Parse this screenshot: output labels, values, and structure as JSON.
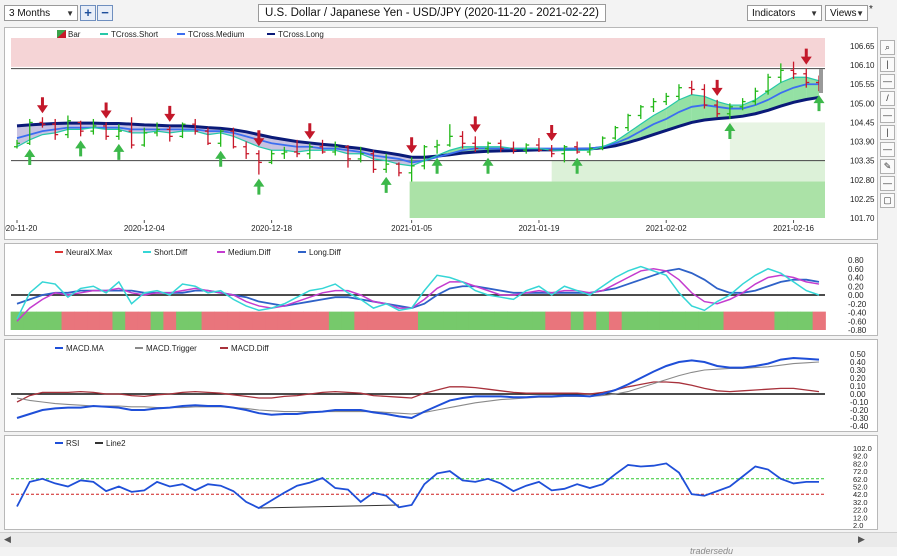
{
  "toolbar": {
    "period_select": "3 Months",
    "add_btn": "+",
    "remove_btn": "−",
    "chart_title": "U.S. Dollar / Japanese Yen - USD/JPY (2020-11-20 - 2021-02-22)",
    "indicators_select": "Indicators",
    "views_select": "Views",
    "star": "*"
  },
  "right_tools": [
    "⌕",
    "|",
    "—",
    "/",
    "—",
    "|",
    "—",
    "✎",
    "—",
    "▢"
  ],
  "watermark": "tradersedu",
  "colors": {
    "up": "#22b818",
    "down": "#c8182a",
    "tcross_short": "#27c8a8",
    "tcross_medium": "#3c6ef0",
    "tcross_long": "#0a1a78",
    "short_diff": "#35d6d6",
    "medium_diff": "#c43ccf",
    "long_diff": "#2f62c8",
    "macd_ma": "#1f4fd8",
    "macd_trigger": "#8a8a8a",
    "macd_diff": "#a8323c",
    "rsi": "#1f4fd8",
    "line2": "#333333",
    "level_green": "#2ec82e",
    "level_red": "#cf1f1f"
  },
  "chart_data": [
    {
      "type": "candlestick",
      "legend": [
        "Bar",
        "TCross.Short",
        "TCross.Medium",
        "TCross.Long"
      ],
      "x_tick_labels": [
        "2020-11-20",
        "2020-12-04",
        "2020-12-18",
        "2021-01-05",
        "2021-01-19",
        "2021-02-02",
        "2021-02-16"
      ],
      "x_tick_index": [
        0,
        10,
        20,
        31,
        41,
        51,
        61
      ],
      "y_tick_labels": [
        "106.65",
        "106.10",
        "105.55",
        "105.00",
        "104.45",
        "103.90",
        "103.35",
        "102.80",
        "102.25",
        "101.70"
      ],
      "ylim": [
        101.7,
        106.65
      ],
      "ohlc": [
        [
          103.75,
          103.95,
          103.7,
          103.85
        ],
        [
          103.85,
          104.55,
          103.8,
          104.45
        ],
        [
          104.45,
          104.6,
          104.3,
          104.4
        ],
        [
          104.4,
          104.55,
          103.95,
          104.1
        ],
        [
          104.1,
          104.65,
          104.0,
          104.5
        ],
        [
          104.45,
          104.5,
          104.05,
          104.2
        ],
        [
          104.2,
          104.55,
          104.1,
          104.35
        ],
        [
          104.35,
          104.45,
          103.95,
          104.05
        ],
        [
          104.05,
          104.4,
          103.95,
          104.2
        ],
        [
          104.2,
          104.6,
          103.7,
          103.8
        ],
        [
          103.8,
          104.3,
          103.75,
          104.15
        ],
        [
          104.15,
          104.45,
          104.05,
          104.25
        ],
        [
          104.25,
          104.35,
          103.9,
          104.05
        ],
        [
          104.05,
          104.45,
          104.0,
          104.4
        ],
        [
          104.4,
          104.55,
          104.1,
          104.2
        ],
        [
          104.2,
          104.3,
          103.8,
          103.85
        ],
        [
          103.85,
          104.25,
          103.75,
          104.2
        ],
        [
          104.2,
          104.3,
          103.7,
          103.75
        ],
        [
          103.75,
          103.9,
          103.4,
          103.55
        ],
        [
          103.55,
          103.65,
          102.95,
          103.3
        ],
        [
          103.3,
          103.65,
          103.25,
          103.55
        ],
        [
          103.55,
          103.75,
          103.4,
          103.6
        ],
        [
          103.6,
          103.95,
          103.45,
          103.55
        ],
        [
          103.55,
          103.85,
          103.4,
          103.75
        ],
        [
          103.75,
          103.95,
          103.55,
          103.6
        ],
        [
          103.6,
          103.9,
          103.5,
          103.75
        ],
        [
          103.75,
          103.8,
          103.15,
          103.4
        ],
        [
          103.4,
          103.75,
          103.3,
          103.55
        ],
        [
          103.55,
          103.65,
          103.0,
          103.1
        ],
        [
          103.1,
          103.55,
          103.0,
          103.25
        ],
        [
          103.25,
          103.3,
          102.9,
          103.0
        ],
        [
          103.0,
          103.45,
          102.75,
          103.2
        ],
        [
          103.2,
          103.8,
          103.1,
          103.75
        ],
        [
          103.75,
          103.95,
          103.55,
          103.8
        ],
        [
          103.8,
          104.4,
          103.75,
          104.05
        ],
        [
          104.05,
          104.2,
          103.7,
          103.85
        ],
        [
          103.85,
          104.05,
          103.6,
          103.7
        ],
        [
          103.7,
          103.9,
          103.55,
          103.85
        ],
        [
          103.85,
          103.95,
          103.6,
          103.7
        ],
        [
          103.7,
          103.9,
          103.55,
          103.65
        ],
        [
          103.65,
          103.85,
          103.55,
          103.8
        ],
        [
          103.8,
          104.0,
          103.6,
          103.65
        ],
        [
          103.65,
          103.8,
          103.45,
          103.55
        ],
        [
          103.55,
          103.8,
          103.3,
          103.75
        ],
        [
          103.75,
          103.9,
          103.55,
          103.6
        ],
        [
          103.6,
          103.85,
          103.5,
          103.7
        ],
        [
          103.7,
          104.05,
          103.65,
          104.0
        ],
        [
          104.0,
          104.35,
          103.95,
          104.3
        ],
        [
          104.3,
          104.7,
          104.2,
          104.65
        ],
        [
          104.65,
          104.95,
          104.55,
          104.9
        ],
        [
          104.9,
          105.15,
          104.75,
          105.05
        ],
        [
          105.05,
          105.3,
          104.95,
          105.2
        ],
        [
          105.2,
          105.55,
          105.1,
          105.45
        ],
        [
          105.45,
          105.65,
          105.25,
          105.4
        ],
        [
          105.4,
          105.55,
          104.85,
          104.95
        ],
        [
          104.95,
          105.1,
          104.6,
          104.7
        ],
        [
          104.7,
          105.0,
          104.55,
          104.9
        ],
        [
          104.9,
          105.15,
          104.8,
          105.05
        ],
        [
          105.05,
          105.45,
          104.95,
          105.35
        ],
        [
          105.35,
          105.85,
          105.25,
          105.75
        ],
        [
          105.75,
          106.15,
          105.6,
          105.95
        ],
        [
          105.95,
          106.2,
          105.7,
          105.85
        ],
        [
          105.85,
          106.0,
          105.45,
          105.6
        ],
        [
          105.6,
          105.8,
          105.35,
          105.45
        ]
      ],
      "tcross_short": [
        103.75,
        103.95,
        104.1,
        104.15,
        104.25,
        104.25,
        104.3,
        104.25,
        104.25,
        104.15,
        104.15,
        104.2,
        104.15,
        104.2,
        104.2,
        104.1,
        104.15,
        104.05,
        103.9,
        103.75,
        103.65,
        103.65,
        103.6,
        103.65,
        103.65,
        103.65,
        103.55,
        103.55,
        103.4,
        103.35,
        103.25,
        103.2,
        103.35,
        103.5,
        103.65,
        103.75,
        103.75,
        103.75,
        103.75,
        103.7,
        103.7,
        103.7,
        103.65,
        103.65,
        103.65,
        103.65,
        103.75,
        103.9,
        104.15,
        104.4,
        104.65,
        104.85,
        105.1,
        105.25,
        105.2,
        105.05,
        104.95,
        104.95,
        105.1,
        105.35,
        105.6,
        105.75,
        105.75,
        105.65
      ],
      "tcross_medium": [
        104.0,
        104.1,
        104.2,
        104.25,
        104.3,
        104.3,
        104.3,
        104.3,
        104.3,
        104.25,
        104.25,
        104.25,
        104.25,
        104.25,
        104.25,
        104.2,
        104.2,
        104.15,
        104.05,
        103.95,
        103.85,
        103.8,
        103.75,
        103.75,
        103.7,
        103.7,
        103.65,
        103.6,
        103.5,
        103.45,
        103.4,
        103.3,
        103.35,
        103.45,
        103.55,
        103.65,
        103.7,
        103.7,
        103.7,
        103.7,
        103.7,
        103.7,
        103.7,
        103.7,
        103.7,
        103.7,
        103.75,
        103.85,
        104.0,
        104.2,
        104.4,
        104.55,
        104.75,
        104.9,
        104.95,
        104.9,
        104.85,
        104.85,
        104.95,
        105.1,
        105.3,
        105.45,
        105.55,
        105.55
      ],
      "tcross_long": [
        104.35,
        104.38,
        104.4,
        104.42,
        104.43,
        104.43,
        104.43,
        104.42,
        104.42,
        104.4,
        104.38,
        104.37,
        104.35,
        104.35,
        104.33,
        104.3,
        104.28,
        104.24,
        104.18,
        104.1,
        104.02,
        103.96,
        103.9,
        103.86,
        103.82,
        103.79,
        103.74,
        103.7,
        103.63,
        103.58,
        103.52,
        103.45,
        103.45,
        103.48,
        103.52,
        103.57,
        103.6,
        103.62,
        103.63,
        103.64,
        103.65,
        103.66,
        103.66,
        103.67,
        103.68,
        103.69,
        103.72,
        103.78,
        103.87,
        103.98,
        104.1,
        104.22,
        104.34,
        104.45,
        104.52,
        104.56,
        104.59,
        104.63,
        104.7,
        104.8,
        104.92,
        105.03,
        105.11,
        105.17
      ],
      "signals_down": [
        2,
        7,
        12,
        19,
        23,
        31,
        36,
        42,
        55,
        62
      ],
      "signals_up": [
        1,
        5,
        8,
        16,
        19,
        29,
        33,
        37,
        44,
        56,
        64
      ]
    },
    {
      "type": "line",
      "legend": [
        "NeuralX.Max",
        "Short.Diff",
        "Medium.Diff",
        "Long.Diff"
      ],
      "y_tick_labels": [
        "0.80",
        "0.60",
        "0.40",
        "0.20",
        "0.00",
        "-0.20",
        "-0.40",
        "-0.60",
        "-0.80"
      ],
      "ylim": [
        -0.8,
        0.8
      ],
      "short_diff": [
        -0.55,
        0.05,
        0.3,
        0.25,
        -0.05,
        0.15,
        0.2,
        0.05,
        0.3,
        -0.2,
        0.05,
        0.1,
        0.0,
        0.25,
        0.2,
        0.05,
        0.1,
        -0.1,
        -0.25,
        -0.35,
        -0.3,
        -0.2,
        -0.05,
        0.1,
        0.15,
        0.25,
        0.05,
        -0.1,
        -0.3,
        -0.2,
        -0.35,
        -0.3,
        0.1,
        0.45,
        0.4,
        0.3,
        0.1,
        0.0,
        -0.05,
        -0.1,
        0.1,
        0.2,
        0.0,
        0.2,
        0.1,
        0.0,
        0.2,
        0.4,
        0.55,
        0.65,
        0.55,
        0.45,
        0.05,
        -0.25,
        -0.35,
        -0.15,
        0.0,
        0.25,
        0.45,
        0.6,
        0.5,
        0.3,
        0.1,
        0.0
      ],
      "medium_diff": [
        -0.6,
        -0.3,
        -0.1,
        0.05,
        0.0,
        0.05,
        0.1,
        0.1,
        0.15,
        0.05,
        0.0,
        0.05,
        0.05,
        0.1,
        0.15,
        0.1,
        0.05,
        0.0,
        -0.15,
        -0.25,
        -0.3,
        -0.25,
        -0.15,
        -0.05,
        0.05,
        0.1,
        0.1,
        0.0,
        -0.15,
        -0.2,
        -0.3,
        -0.3,
        -0.1,
        0.15,
        0.3,
        0.3,
        0.2,
        0.1,
        0.0,
        0.0,
        0.05,
        0.1,
        0.05,
        0.1,
        0.1,
        0.05,
        0.1,
        0.25,
        0.4,
        0.55,
        0.6,
        0.55,
        0.35,
        0.05,
        -0.15,
        -0.2,
        -0.1,
        0.05,
        0.25,
        0.4,
        0.45,
        0.4,
        0.3,
        0.25
      ],
      "long_diff": [
        -0.2,
        -0.1,
        0.0,
        0.05,
        0.05,
        0.1,
        0.1,
        0.1,
        0.1,
        0.1,
        0.05,
        0.05,
        0.05,
        0.05,
        0.1,
        0.1,
        0.05,
        0.0,
        -0.05,
        -0.15,
        -0.2,
        -0.25,
        -0.2,
        -0.15,
        -0.1,
        -0.05,
        -0.05,
        -0.1,
        -0.15,
        -0.2,
        -0.25,
        -0.3,
        -0.2,
        0.0,
        0.15,
        0.2,
        0.2,
        0.15,
        0.1,
        0.05,
        0.05,
        0.05,
        0.05,
        0.05,
        0.05,
        0.05,
        0.1,
        0.15,
        0.25,
        0.35,
        0.45,
        0.55,
        0.6,
        0.5,
        0.35,
        0.15,
        0.05,
        0.05,
        0.1,
        0.2,
        0.3,
        0.35,
        0.35,
        0.3
      ],
      "neuralx_bar": [
        "g",
        "g",
        "g",
        "g",
        "r",
        "r",
        "r",
        "r",
        "g",
        "r",
        "r",
        "g",
        "r",
        "g",
        "g",
        "r",
        "r",
        "r",
        "r",
        "r",
        "r",
        "r",
        "r",
        "r",
        "r",
        "g",
        "g",
        "r",
        "r",
        "r",
        "r",
        "r",
        "g",
        "g",
        "g",
        "g",
        "g",
        "g",
        "g",
        "g",
        "g",
        "g",
        "r",
        "r",
        "g",
        "r",
        "g",
        "r",
        "g",
        "g",
        "g",
        "g",
        "g",
        "g",
        "g",
        "g",
        "r",
        "r",
        "r",
        "r",
        "g",
        "g",
        "g",
        "r"
      ]
    },
    {
      "type": "line",
      "legend": [
        "MACD.MA",
        "MACD.Trigger",
        "MACD.Diff"
      ],
      "y_tick_labels": [
        "0.50",
        "0.40",
        "0.30",
        "0.20",
        "0.10",
        "0.00",
        "-0.10",
        "-0.20",
        "-0.30",
        "-0.40"
      ],
      "ylim": [
        -0.4,
        0.5
      ],
      "macd_ma": [
        -0.3,
        -0.25,
        -0.2,
        -0.18,
        -0.17,
        -0.17,
        -0.15,
        -0.16,
        -0.17,
        -0.2,
        -0.2,
        -0.18,
        -0.17,
        -0.15,
        -0.14,
        -0.15,
        -0.15,
        -0.17,
        -0.2,
        -0.24,
        -0.26,
        -0.25,
        -0.25,
        -0.23,
        -0.22,
        -0.2,
        -0.2,
        -0.2,
        -0.23,
        -0.25,
        -0.28,
        -0.3,
        -0.22,
        -0.15,
        -0.08,
        -0.05,
        -0.03,
        -0.03,
        -0.03,
        -0.04,
        -0.04,
        -0.03,
        -0.03,
        -0.02,
        -0.02,
        -0.03,
        0.0,
        0.05,
        0.12,
        0.2,
        0.28,
        0.35,
        0.4,
        0.42,
        0.4,
        0.35,
        0.33,
        0.33,
        0.35,
        0.38,
        0.43,
        0.45,
        0.44,
        0.43
      ],
      "macd_trigger": [
        -0.05,
        -0.08,
        -0.1,
        -0.12,
        -0.13,
        -0.14,
        -0.15,
        -0.15,
        -0.15,
        -0.16,
        -0.16,
        -0.17,
        -0.17,
        -0.17,
        -0.16,
        -0.16,
        -0.16,
        -0.17,
        -0.18,
        -0.2,
        -0.21,
        -0.22,
        -0.22,
        -0.22,
        -0.22,
        -0.22,
        -0.22,
        -0.22,
        -0.22,
        -0.23,
        -0.24,
        -0.25,
        -0.23,
        -0.2,
        -0.17,
        -0.14,
        -0.11,
        -0.09,
        -0.07,
        -0.06,
        -0.05,
        -0.04,
        -0.04,
        -0.03,
        -0.03,
        -0.03,
        -0.02,
        0.0,
        0.03,
        0.08,
        0.13,
        0.18,
        0.23,
        0.27,
        0.3,
        0.31,
        0.32,
        0.32,
        0.33,
        0.34,
        0.36,
        0.38,
        0.39,
        0.4
      ],
      "macd_diff": [
        -0.1,
        -0.02,
        0.02,
        0.02,
        0.02,
        0.03,
        0.02,
        0.0,
        0.0,
        -0.02,
        -0.03,
        -0.01,
        0.0,
        0.02,
        0.03,
        0.02,
        0.01,
        -0.01,
        -0.03,
        -0.05,
        -0.05,
        -0.03,
        -0.02,
        0.0,
        0.02,
        0.03,
        0.02,
        0.01,
        -0.02,
        -0.03,
        -0.04,
        -0.05,
        0.01,
        0.05,
        0.09,
        0.09,
        0.08,
        0.06,
        0.04,
        0.02,
        0.01,
        0.01,
        0.01,
        0.01,
        0.01,
        0.0,
        0.02,
        0.05,
        0.09,
        0.12,
        0.15,
        0.15,
        0.14,
        0.11,
        0.07,
        0.04,
        0.03,
        0.04,
        0.05,
        0.06,
        0.07,
        0.07,
        0.05,
        0.03
      ]
    },
    {
      "type": "line",
      "legend": [
        "RSI",
        "Line2"
      ],
      "y_tick_labels": [
        "102.0",
        "92.0",
        "82.0",
        "72.0",
        "62.0",
        "52.0",
        "42.0",
        "32.0",
        "22.0",
        "12.0",
        "2.0"
      ],
      "ylim": [
        2,
        102
      ],
      "levels": [
        62,
        42
      ],
      "rsi": [
        26,
        58,
        62,
        56,
        52,
        60,
        58,
        46,
        52,
        45,
        47,
        58,
        52,
        55,
        47,
        55,
        53,
        46,
        32,
        24,
        34,
        44,
        53,
        57,
        63,
        50,
        48,
        32,
        44,
        40,
        25,
        28,
        55,
        69,
        72,
        60,
        58,
        62,
        56,
        46,
        53,
        58,
        47,
        49,
        55,
        50,
        55,
        68,
        80,
        78,
        79,
        82,
        70,
        42,
        40,
        46,
        52,
        65,
        78,
        74,
        62,
        56,
        58,
        58
      ],
      "line2_from": [
        19,
        24
      ],
      "line2_to": [
        30,
        28
      ]
    }
  ]
}
